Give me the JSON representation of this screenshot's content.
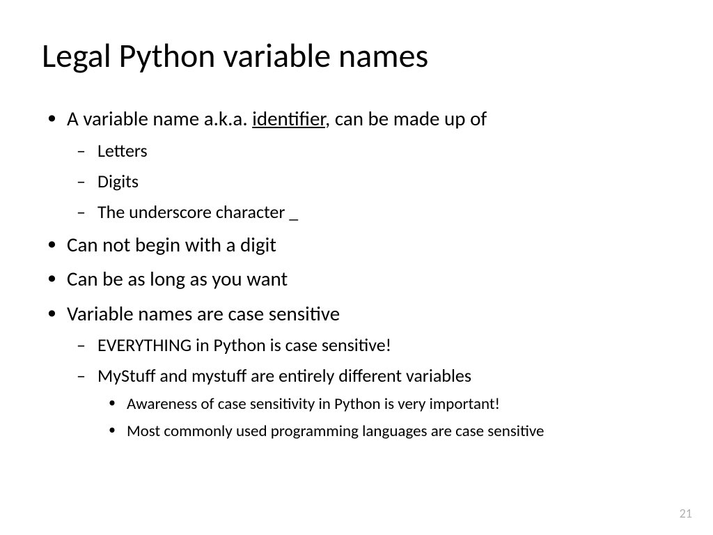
{
  "slide": {
    "title": "Legal Python variable names",
    "pageNumber": "21",
    "bullets": {
      "b1_pre": "A variable name a.k.a. ",
      "b1_underlined": "identifier",
      "b1_post": ", can be made up of",
      "b1_sub1": "Letters",
      "b1_sub2": "Digits",
      "b1_sub3": "The underscore character _",
      "b2": "Can not begin with a digit",
      "b3": "Can be as long as you want",
      "b4": "Variable names are case sensitive",
      "b4_sub1": "EVERYTHING in Python is case sensitive!",
      "b4_sub2": "MyStuff and mystuff are entirely different variables",
      "b4_sub2_sub1": "Awareness of case sensitivity in Python is very important!",
      "b4_sub2_sub2": "Most commonly used programming languages are case sensitive"
    }
  }
}
